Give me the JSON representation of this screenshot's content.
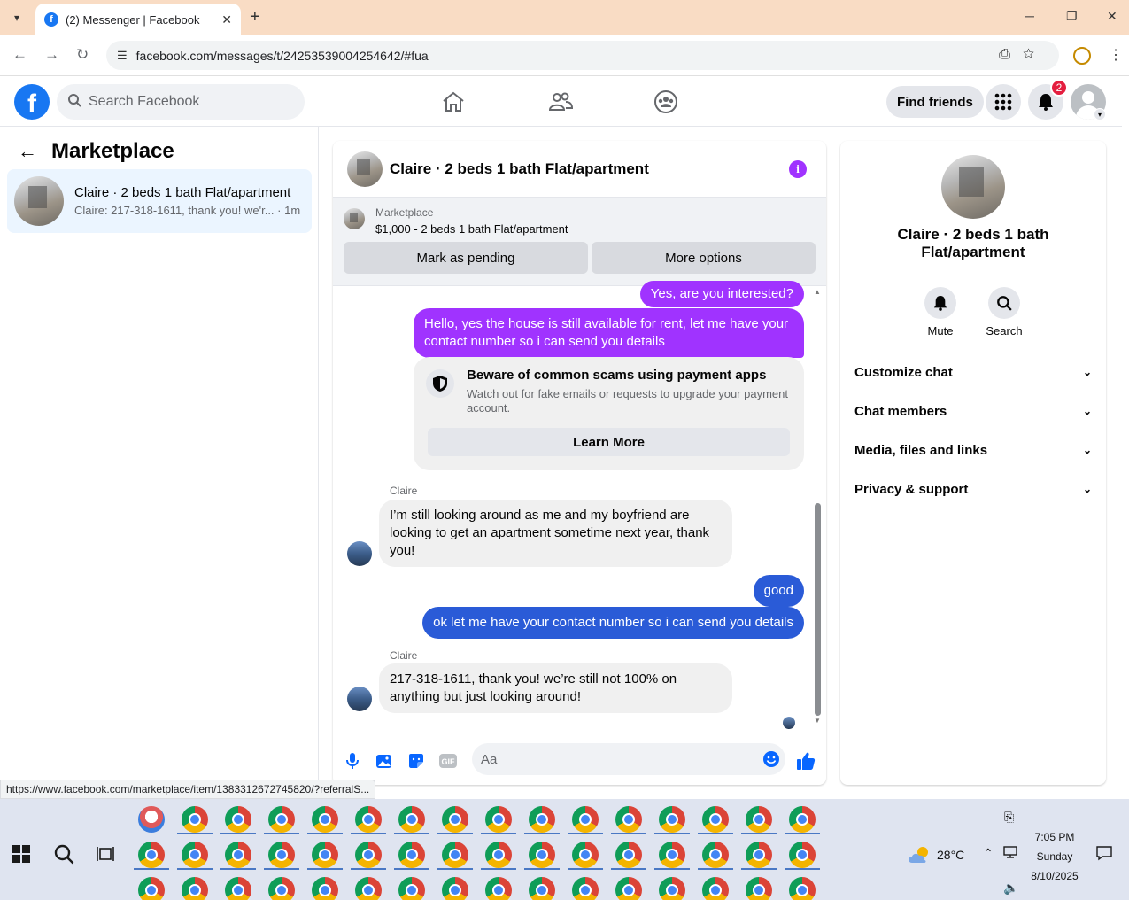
{
  "browser": {
    "tab_title": "(2) Messenger | Facebook",
    "url": "facebook.com/messages/t/24253539004254642/#fua",
    "status_link": "https://www.facebook.com/marketplace/item/1383312672745820/?referralS..."
  },
  "fb_header": {
    "search_placeholder": "Search Facebook",
    "find_friends": "Find friends",
    "notification_count": "2"
  },
  "left": {
    "title": "Marketplace",
    "conversation": {
      "name": "Claire · 2 beds 1 bath Flat/apartment",
      "preview": "Claire: 217-318-1611, thank you! we'r... · 1m"
    }
  },
  "chat": {
    "title": "Claire · 2 beds 1 bath Flat/apartment",
    "marketplace_label": "Marketplace",
    "listing": "$1,000 - 2 beds 1 bath Flat/apartment",
    "mark_pending": "Mark as pending",
    "more_options": "More options",
    "messages": {
      "m1": "Yes, are you interested?",
      "m2": "Hello, yes the house is still available for rent, let me have your contact number so i can send you details",
      "warning_title": "Beware of common scams using payment apps",
      "warning_desc": "Watch out for fake emails or requests to upgrade your payment account.",
      "learn_more": "Learn More",
      "sender1": "Claire",
      "m3": "I’m still looking around as me and my boyfriend are looking to get an apartment sometime next year, thank you!",
      "m4": "good",
      "m5": "ok let me have your contact number so i can send you details",
      "sender2": "Claire",
      "m6": "217-318-1611, thank you! we’re still not 100% on anything but just looking around!"
    },
    "composer_placeholder": "Aa"
  },
  "right": {
    "name": "Claire · 2 beds 1 bath Flat/apartment",
    "mute": "Mute",
    "search": "Search",
    "sections": [
      "Customize chat",
      "Chat members",
      "Media, files and links",
      "Privacy & support"
    ]
  },
  "taskbar": {
    "temperature": "28°C",
    "time": "7:05 PM",
    "day": "Sunday",
    "date": "8/10/2025"
  },
  "colors": {
    "fb_blue": "#1877f2",
    "outgoing_purple": "#a033ff",
    "outgoing_blue": "#2a5bd7",
    "selected_conv": "#ebf5ff"
  }
}
